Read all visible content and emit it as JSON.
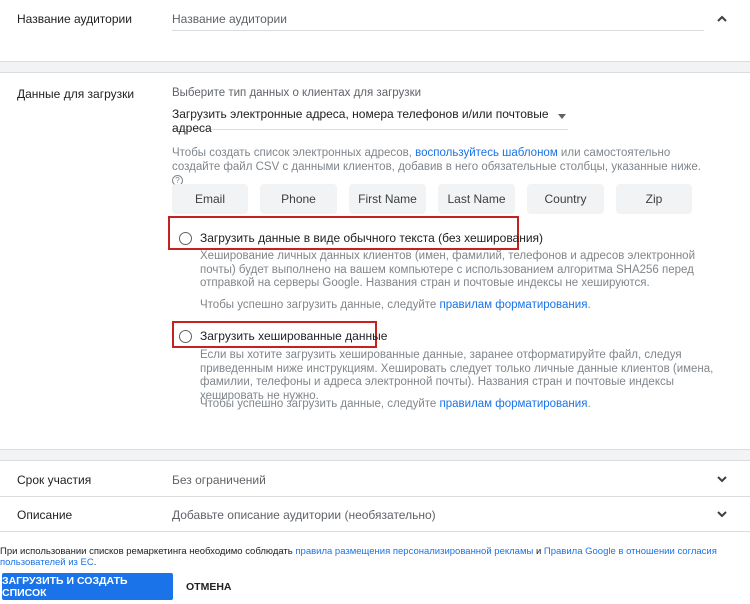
{
  "audience_name": {
    "label": "Название аудитории",
    "placeholder": "Название аудитории"
  },
  "upload_data": {
    "label": "Данные для загрузки",
    "hint": "Выберите тип данных о клиентах для загрузки",
    "selected_type": "Загрузить электронные адреса, номера телефонов и/или почтовые адреса",
    "instructions_before": "Чтобы создать список электронных адресов, ",
    "instructions_link": "воспользуйтесь шаблоном",
    "instructions_after": " или самостоятельно создайте файл CSV с данными клиентов, добавив в него обязательные столбцы, указанные ниже.",
    "help_icon": "?",
    "columns": [
      "Email",
      "Phone",
      "First Name",
      "Last Name",
      "Country",
      "Zip"
    ],
    "option_plain": {
      "label": "Загрузить данные в виде обычного текста (без хеширования)",
      "description": "Хеширование личных данных клиентов (имен, фамилий, телефонов и адресов электронной почты) будет выполнено на вашем компьютере с использованием алгоритма SHA256 перед отправкой на серверы Google. Названия стран и почтовые индексы не хешируются.",
      "format_text": "Чтобы успешно загрузить данные, следуйте ",
      "format_link": "правилам форматирования",
      "format_end": "."
    },
    "option_hashed": {
      "label": "Загрузить хешированные данные",
      "description": "Если вы хотите загрузить хешированные данные, заранее отформатируйте файл, следуя приведенным ниже инструкциям. Хешировать следует только личные данные клиентов (имена, фамилии, телефоны и адреса электронной почты). Названия стран и почтовые индексы хешировать не нужно.",
      "format_text": "Чтобы успешно загрузить данные, следуйте ",
      "format_link": "правилам форматирования",
      "format_end": "."
    }
  },
  "membership": {
    "label": "Срок участия",
    "value": "Без ограничений"
  },
  "description": {
    "label": "Описание",
    "placeholder": "Добавьте описание аудитории (необязательно)"
  },
  "footer": {
    "text_before": "При использовании списков ремаркетинга необходимо соблюдать ",
    "link1": "правила размещения персонализированной рекламы",
    "text_mid": " и ",
    "link2": "Правила Google в отношении согласия пользователей из ЕС",
    "text_end": "."
  },
  "actions": {
    "submit_label": "ЗАГРУЗИТЬ И СОЗДАТЬ СПИСОК",
    "cancel_label": "ОТМЕНА"
  },
  "colors": {
    "accent": "#1a73e8",
    "highlight_border": "#c5221f",
    "chip_bg": "#f1f3f4"
  }
}
